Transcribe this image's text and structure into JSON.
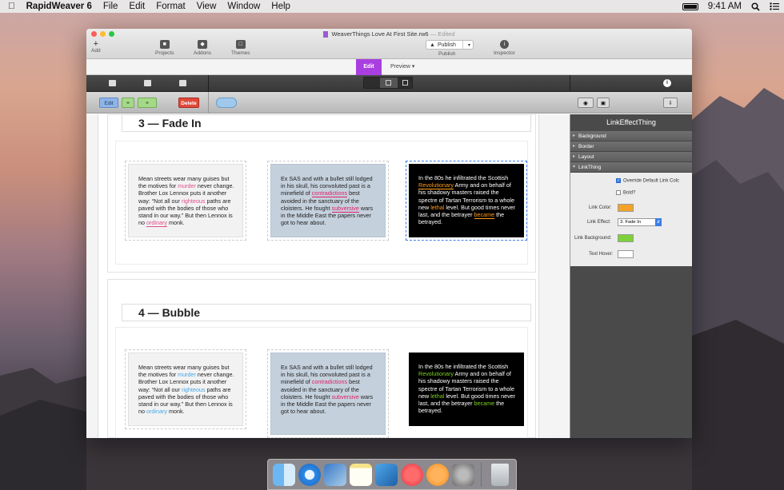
{
  "menubar": {
    "apple": "",
    "app_name": "RapidWeaver 6",
    "items": [
      "File",
      "Edit",
      "Format",
      "View",
      "Window",
      "Help"
    ],
    "time": "9:41 AM"
  },
  "window": {
    "title": "WeaverThings Love At First Site.rw6",
    "edited": "— Edited",
    "toolbar": {
      "add": "Add",
      "projects": "Projects",
      "addons": "Addons",
      "themes": "Themes",
      "publish_btn": "Publish",
      "publish_lbl": "Publish",
      "inspector": "Inspector"
    },
    "tabs": {
      "edit": "Edit",
      "preview": "Preview"
    },
    "actions": {
      "edit": "Edit",
      "delete": "Delete"
    }
  },
  "sections": [
    {
      "heading": "3 — Fade In",
      "card1": {
        "t1": "Mean streets wear many guises but the motives for ",
        "l1": "murder",
        "t2": " never change. Brother Lox Lennox puts it another way: “Not all our ",
        "l2": "righteous",
        "t3": " paths are paved with the bodies of those who stand in our way.” But then Lennox is no ",
        "l3": "ordinary",
        "t4": " monk."
      },
      "card2": {
        "t1": "Ex SAS and with a bullet still lodged in his skull, his convoluted past is a minefield of ",
        "l1": "contradictions",
        "t2": " best avoided in the sanctuary of the cloisters. He fought ",
        "l2": "subversive",
        "t3": " wars in the Middle East the papers never got to hear about."
      },
      "card3": {
        "t1": "In the 80s he infiltrated the Scottish ",
        "l1": "Revolutionary",
        "t2": " Army and on behalf of his shadowy masters raised the spectre of Tartan Terrorism to a whole new ",
        "l2": "lethal",
        "t3": " level. But good times never last, and the betrayer ",
        "l3": "became",
        "t4": " the betrayed."
      }
    },
    {
      "heading": "4 — Bubble",
      "card1": {
        "t1": "Mean streets wear many guises but the motives for ",
        "l1": "murder",
        "t2": " never change. Brother Lox Lennox puts it another way: “Not all our ",
        "l2": "righteous",
        "t3": " paths are paved with the bodies of those who stand in our way.” But then Lennox is no ",
        "l3": "ordinary",
        "t4": " monk."
      },
      "card2": {
        "t1": "Ex SAS and with a bullet still lodged in his skull, his convoluted past is a minefield of ",
        "l1": "contradictions",
        "t2": " best avoided in the sanctuary of the cloisters. He fought ",
        "l2": "subversive",
        "t3": " wars in the Middle East the papers never got to hear about."
      },
      "card3": {
        "t1": "In the 80s he infiltrated the Scottish ",
        "l1": "Revolutionary",
        "t2": " Army and on behalf of his shadowy masters raised the spectre of Tartan Terrorism to a whole new ",
        "l2": "lethal",
        "t3": " level. But good times never last, and the betrayer ",
        "l3": "became",
        "t4": " the betrayed."
      }
    }
  ],
  "inspector": {
    "title": "LinkEffectThing",
    "groups": [
      "Background",
      "Border",
      "Layout",
      "LinkThing"
    ],
    "override": "Override Default Link Colc",
    "bold": "Bold?",
    "link_color_label": "Link Color:",
    "link_effect_label": "Link Effect:",
    "link_effect_value": "3. Fade In",
    "link_bg_label": "Link Background:",
    "text_hover_label": "Text Hover:",
    "colors": {
      "link_color": "#f4a32a",
      "link_background": "#7ed13a",
      "text_hover": "#ffffff"
    }
  },
  "dock": {
    "apps": [
      "finder",
      "safari",
      "preview",
      "notes",
      "xcode",
      "itunes",
      "ibooks",
      "system-preferences",
      "trash"
    ]
  }
}
